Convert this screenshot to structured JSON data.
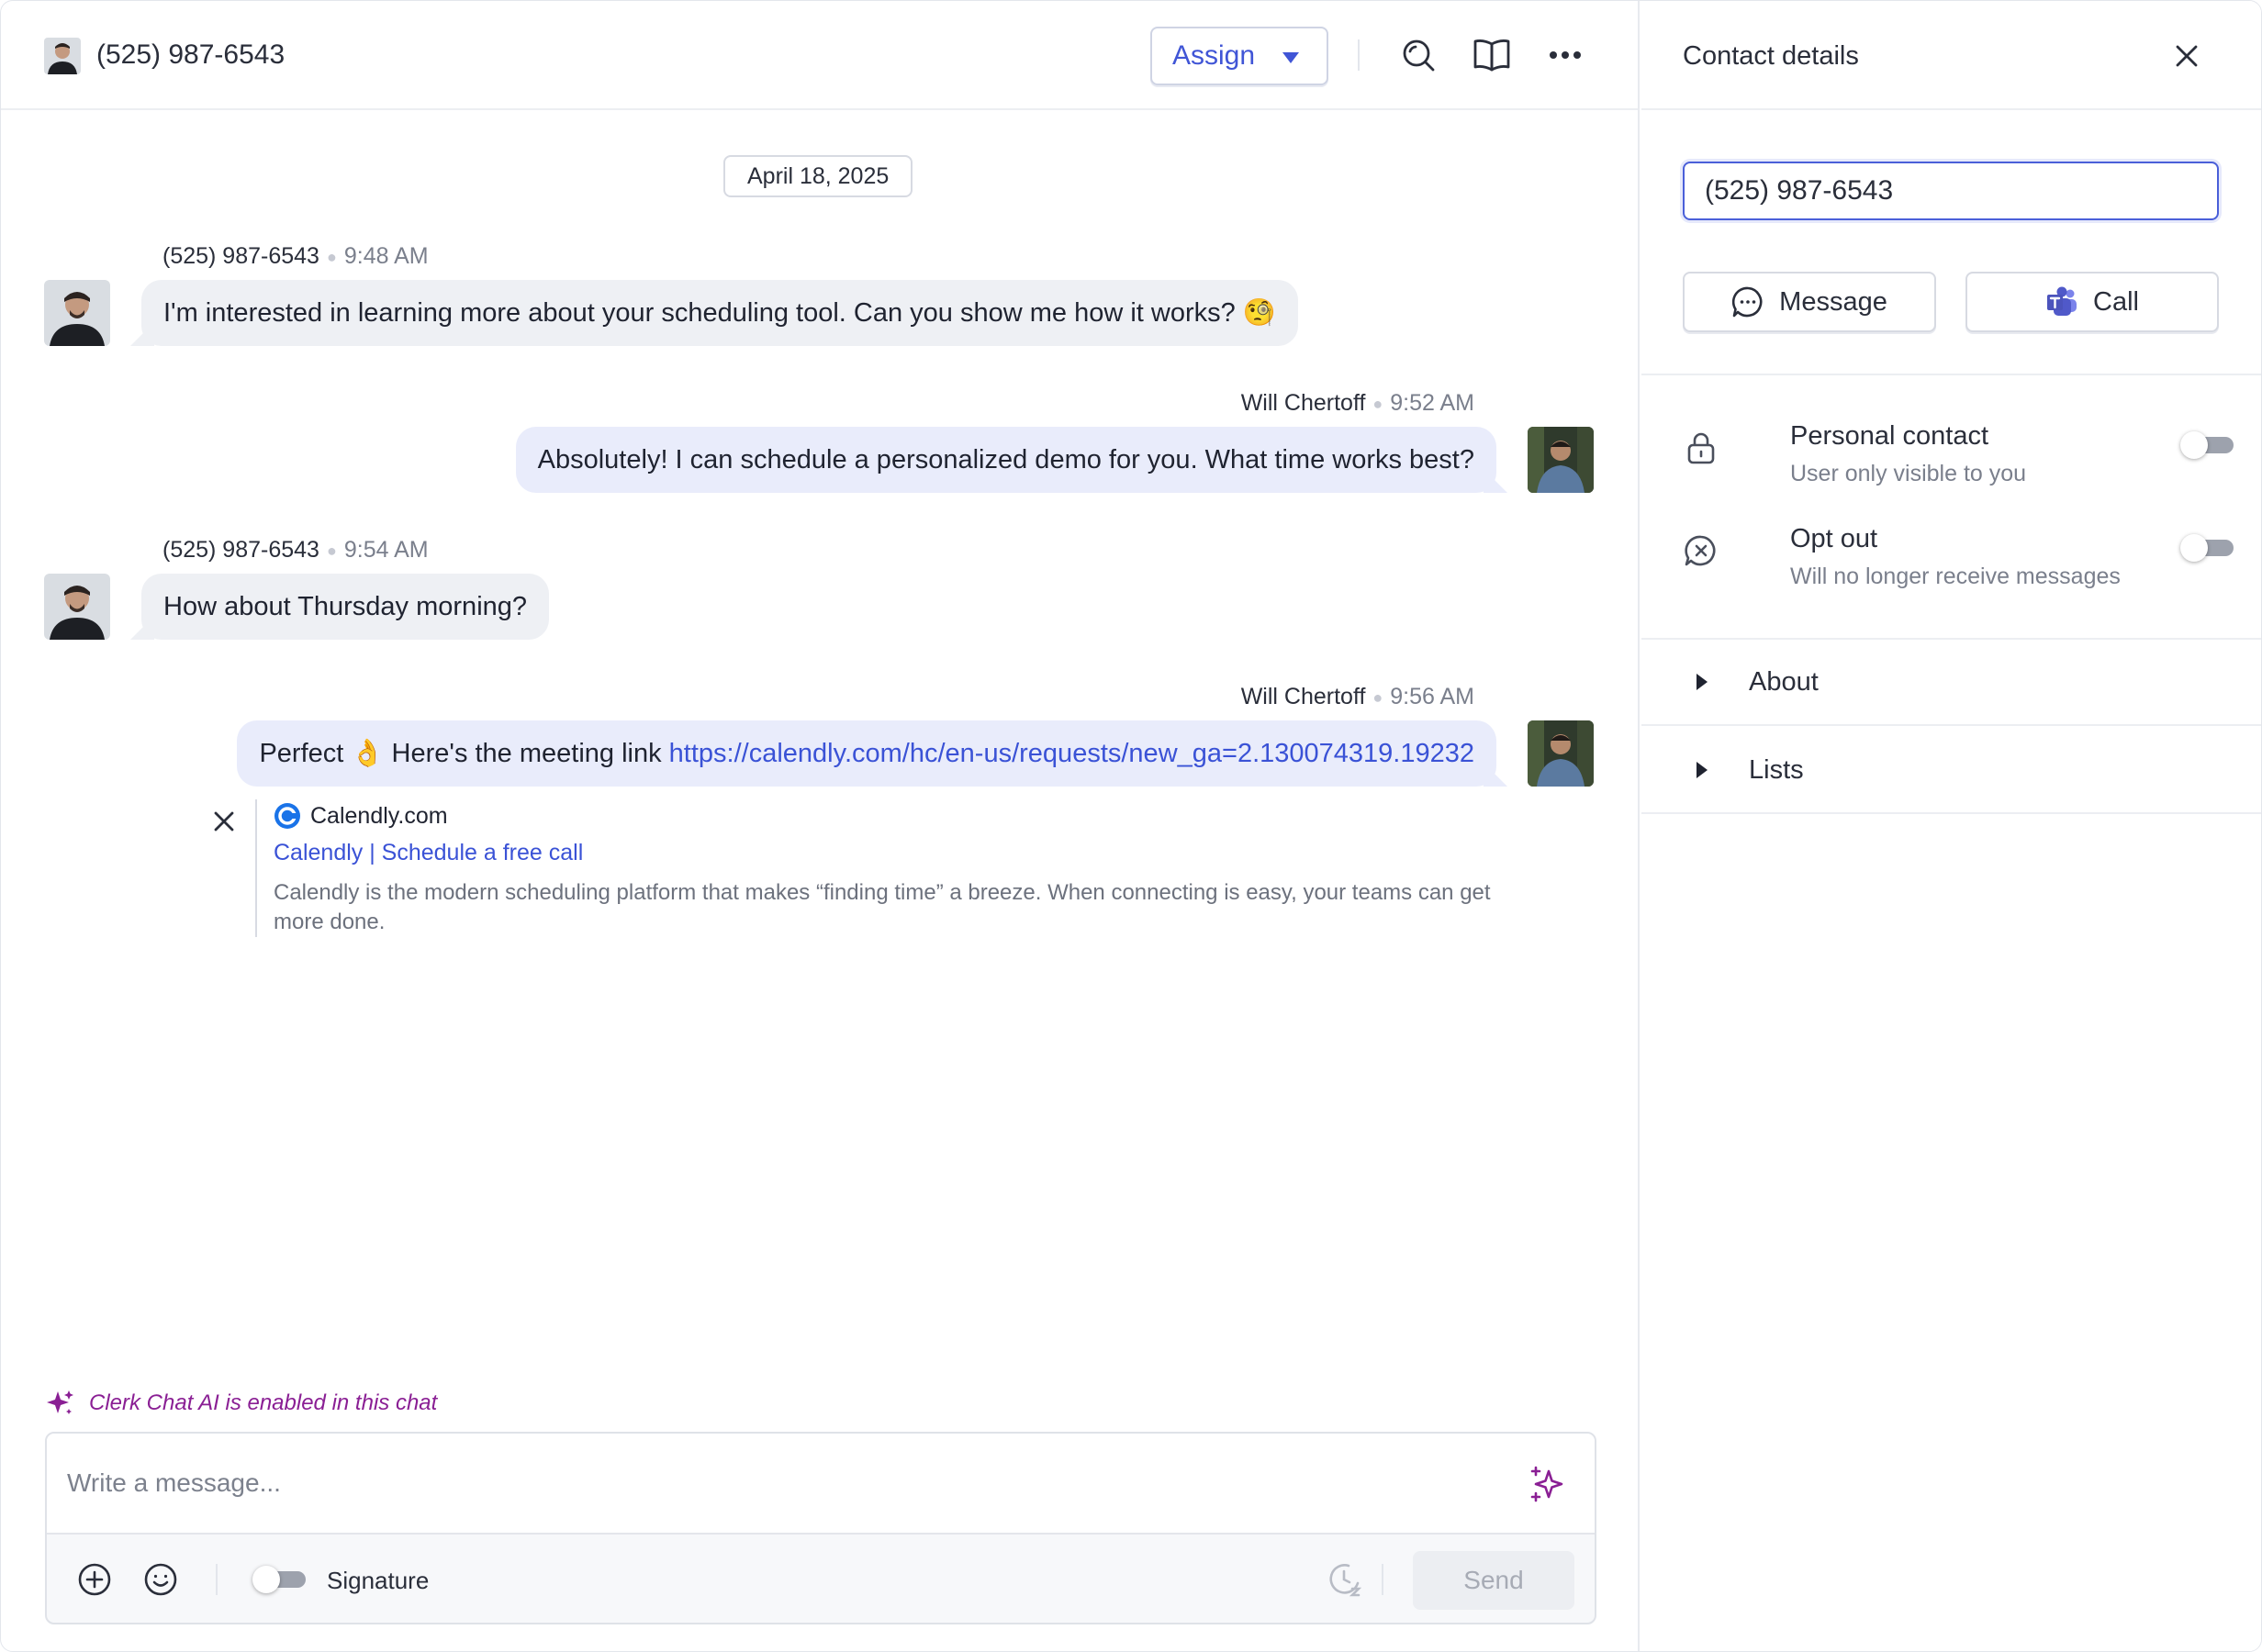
{
  "header": {
    "contact_title": "(525) 987-6543",
    "assign_label": "Assign"
  },
  "date_divider": "April 18, 2025",
  "messages": [
    {
      "sender": "(525) 987-6543",
      "time": "9:48 AM",
      "direction": "in",
      "text": "I'm interested in learning more about your scheduling tool. Can you show me how it works? 🧐"
    },
    {
      "sender": "Will Chertoff",
      "time": "9:52 AM",
      "direction": "out",
      "text": "Absolutely! I can schedule a personalized demo for you. What time works best?"
    },
    {
      "sender": "(525) 987-6543",
      "time": "9:54 AM",
      "direction": "in",
      "text": "How about Thursday morning?"
    },
    {
      "sender": "Will Chertoff",
      "time": "9:56 AM",
      "direction": "out",
      "text_prefix": "Perfect 👌 Here's the meeting link ",
      "link": "https://calendly.com/hc/en-us/requests/new_ga=2.130074319.19232"
    }
  ],
  "link_preview": {
    "site": "Calendly.com",
    "title": "Calendly | Schedule a free call",
    "description": "Calendly is the modern scheduling platform that makes “finding time” a breeze. When connecting is easy, your teams can get more done."
  },
  "composer": {
    "ai_notice": "Clerk Chat AI is enabled in this chat",
    "placeholder": "Write a message...",
    "signature_label": "Signature",
    "send_label": "Send"
  },
  "details": {
    "title": "Contact details",
    "phone_value": "(525) 987-6543",
    "message_label": "Message",
    "call_label": "Call",
    "personal_contact": {
      "title": "Personal contact",
      "subtitle": "User only visible to you",
      "enabled": false
    },
    "opt_out": {
      "title": "Opt out",
      "subtitle": "Will no longer receive messages",
      "enabled": false
    },
    "sections": [
      "About",
      "Lists"
    ]
  },
  "colors": {
    "accent": "#4055d6",
    "ai_purple": "#8a1f94",
    "bubble_in": "#eef0f4",
    "bubble_out": "#e9ecfb"
  }
}
